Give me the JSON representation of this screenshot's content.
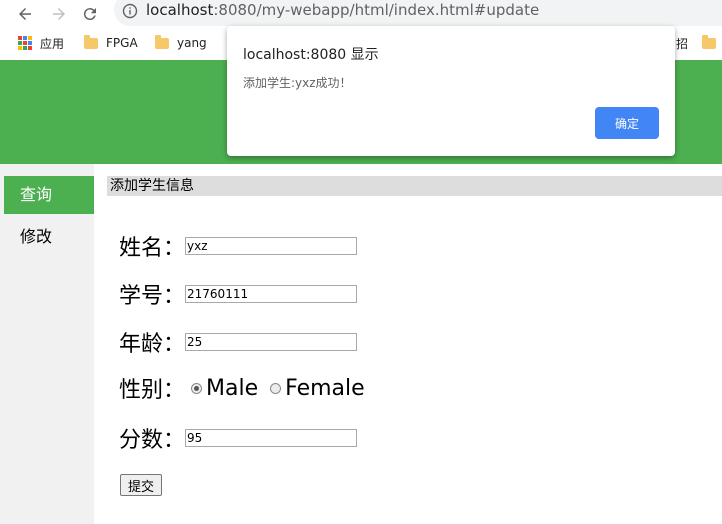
{
  "browser": {
    "url_host": "localhost",
    "url_rest": ":8080/my-webapp/html/index.html#update",
    "bookmarks": [
      "应用",
      "FPGA",
      "yang",
      "招"
    ]
  },
  "sidebar": {
    "items": [
      {
        "label": "查询",
        "active": true
      },
      {
        "label": "修改",
        "active": false
      }
    ]
  },
  "form": {
    "section_title": "添加学生信息",
    "name_label": "姓名：",
    "name_value": "yxz",
    "id_label": "学号：",
    "id_value": "21760111",
    "age_label": "年龄：",
    "age_value": "25",
    "gender_label": "性别：",
    "gender_options": [
      "Male",
      "Female"
    ],
    "gender_selected": "Male",
    "score_label": "分数：",
    "score_value": "95",
    "submit_label": "提交"
  },
  "dialog": {
    "title": "localhost:8080 显示",
    "message": "添加学生:yxz成功！",
    "ok_label": "确定"
  },
  "colors": {
    "accent_green": "#4caf50",
    "dialog_button": "#4285f4"
  }
}
